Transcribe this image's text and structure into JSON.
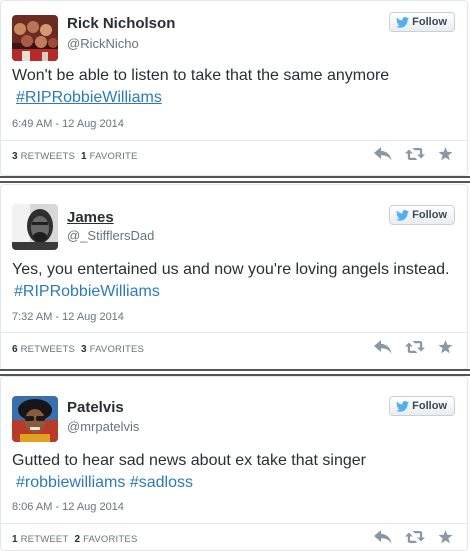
{
  "colors": {
    "link": "#2b7bb9",
    "twitter_blue": "#55acee",
    "action_gray": "#8899a6"
  },
  "follow_label": "Follow",
  "tweets": [
    {
      "name": "Rick Nicholson",
      "handle": "@RickNicho",
      "text_before": "Won't be able to listen to take that the same anymore",
      "hashtags": [
        "#RIPRobbieWilliams"
      ],
      "text_after": "",
      "timestamp": "6:49 AM - 12 Aug 2014",
      "retweets": "3",
      "retweets_label": "RETWEETS",
      "favorites": "1",
      "favorites_label": "FAVORITE"
    },
    {
      "name": "James",
      "handle": "@_StifflersDad",
      "text_before": "Yes, you entertained us and now you're loving angels instead.",
      "hashtags": [
        "#RIPRobbieWilliams"
      ],
      "text_after": "",
      "timestamp": "7:32 AM - 12 Aug 2014",
      "retweets": "6",
      "retweets_label": "RETWEETS",
      "favorites": "3",
      "favorites_label": "FAVORITES"
    },
    {
      "name": "Patelvis",
      "handle": "@mrpatelvis",
      "text_before": "Gutted to hear sad news about ex take that singer",
      "hashtags": [
        "#robbiewilliams",
        "#sadloss"
      ],
      "text_after": "",
      "timestamp": "8:06 AM - 12 Aug 2014",
      "retweets": "1",
      "retweets_label": "RETWEET",
      "favorites": "2",
      "favorites_label": "FAVORITES"
    }
  ]
}
